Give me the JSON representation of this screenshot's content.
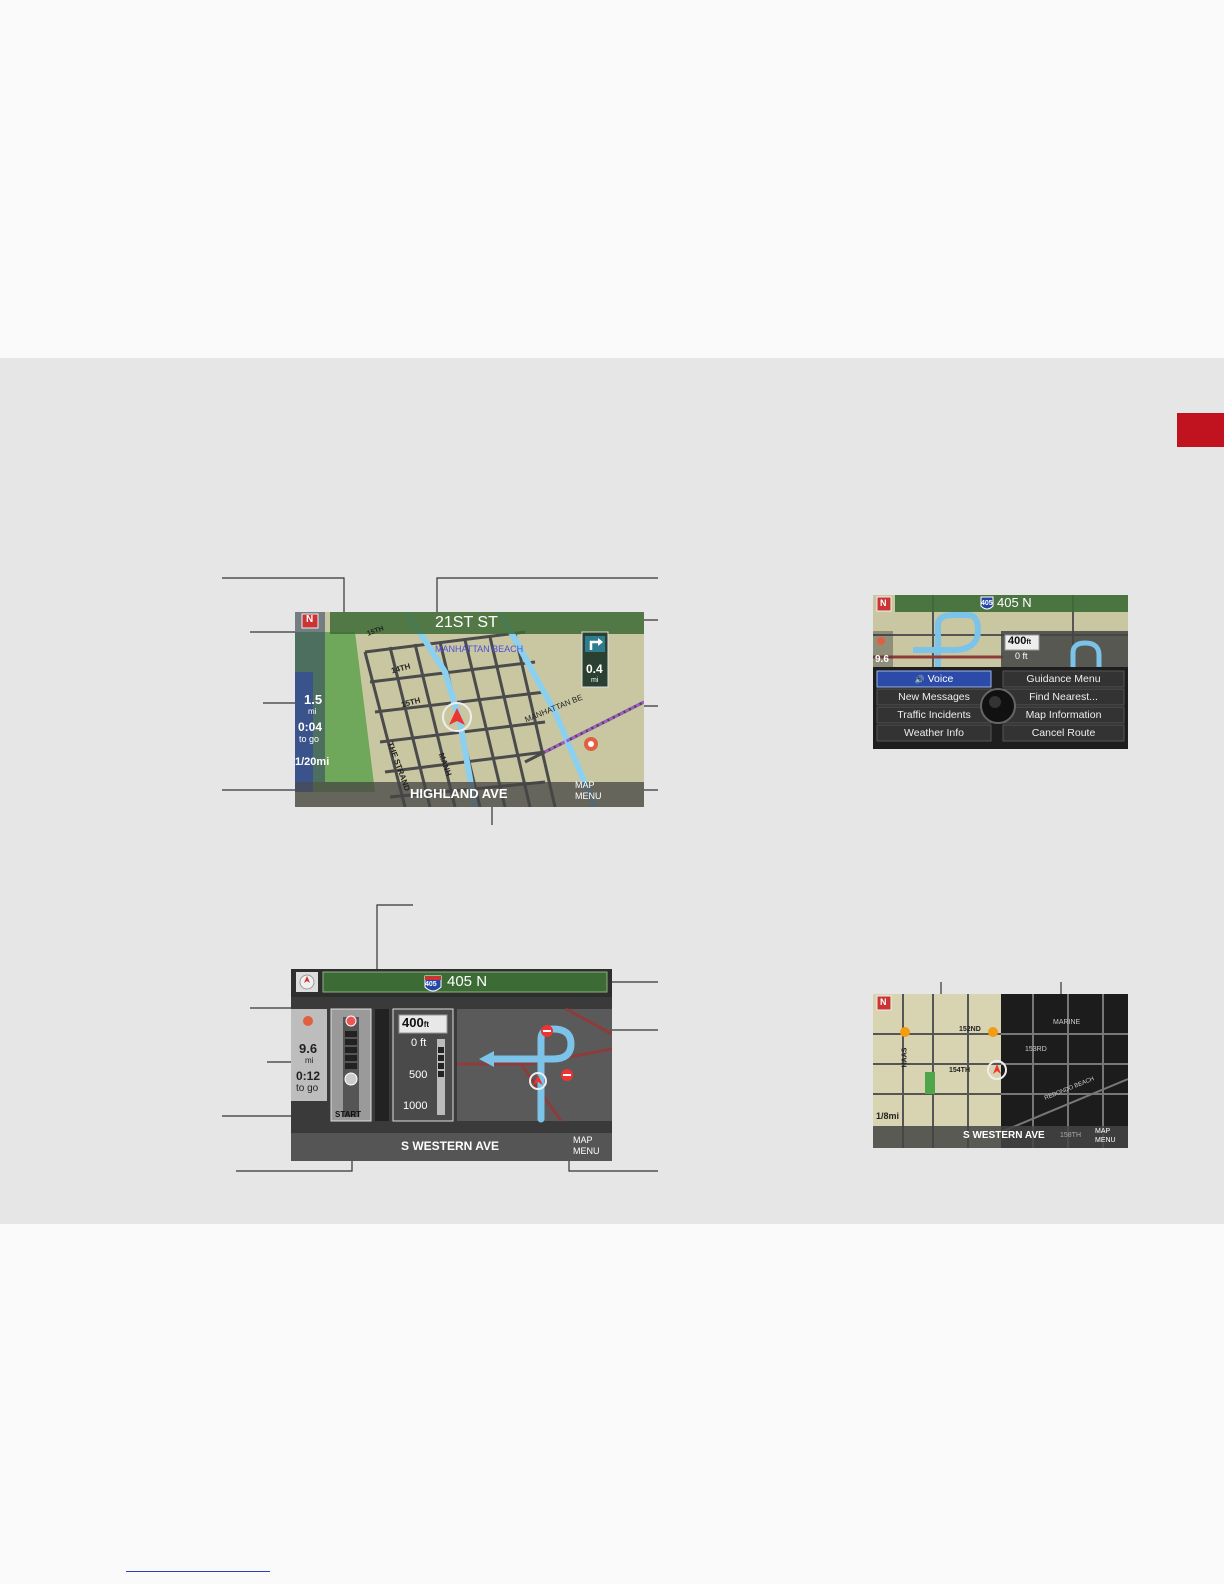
{
  "map_screen": {
    "street_top": "21ST ST",
    "street_bottom": "HIGHLAND AVE",
    "place_label": "MANHATTAN BEACH",
    "place_label_2": "MANHATTAN BE",
    "streets": [
      "15TH",
      "14TH",
      "15TH",
      "THE STRAND",
      "MANH"
    ],
    "compass": "N",
    "distance_value": "1.5",
    "distance_unit": "mi",
    "time_to_go": "0:04",
    "time_label": "to go",
    "scale": "1/20mi",
    "turn_distance_value": "0.4",
    "turn_distance_unit": "mi",
    "map_button_line1": "MAP",
    "map_button_line2": "MENU"
  },
  "guidance_screen": {
    "route": "405 N",
    "shield": "405",
    "distance_value": "9.6",
    "distance_unit": "mi",
    "time_to_go": "0:12",
    "time_label": "to go",
    "progress_label": "START",
    "maneuver_distance": "400",
    "maneuver_unit": "ft",
    "scale_ticks": [
      "0 ft",
      "500",
      "1000"
    ],
    "street_bottom": "S WESTERN AVE",
    "map_button_line1": "MAP",
    "map_button_line2": "MENU"
  },
  "menu_screen": {
    "route": "405 N",
    "shield": "405",
    "compass": "N",
    "distance_value": "9.6",
    "maneuver_distance": "400",
    "maneuver_unit": "ft",
    "scale_tick": "0 ft",
    "menu_items": [
      "Voice",
      "Guidance Menu",
      "New Messages",
      "Find Nearest...",
      "Traffic Incidents",
      "Map Information",
      "Weather Info",
      "Cancel Route"
    ]
  },
  "split_screen": {
    "compass": "N",
    "streets": [
      "152ND",
      "153RD",
      "154TH",
      "HAAS",
      "MARINE",
      "REDONDO BEACH"
    ],
    "scale": "1/8mi",
    "street_bottom": "S WESTERN AVE",
    "street_bottom_2": "158TH",
    "map_button_line1": "MAP",
    "map_button_line2": "MENU"
  },
  "colors": {
    "band": "#e6e6e6",
    "tab": "#c0131f",
    "map_land": "#c8c7a2",
    "route": "#8cd0f0",
    "header_green": "#3d6b35"
  }
}
